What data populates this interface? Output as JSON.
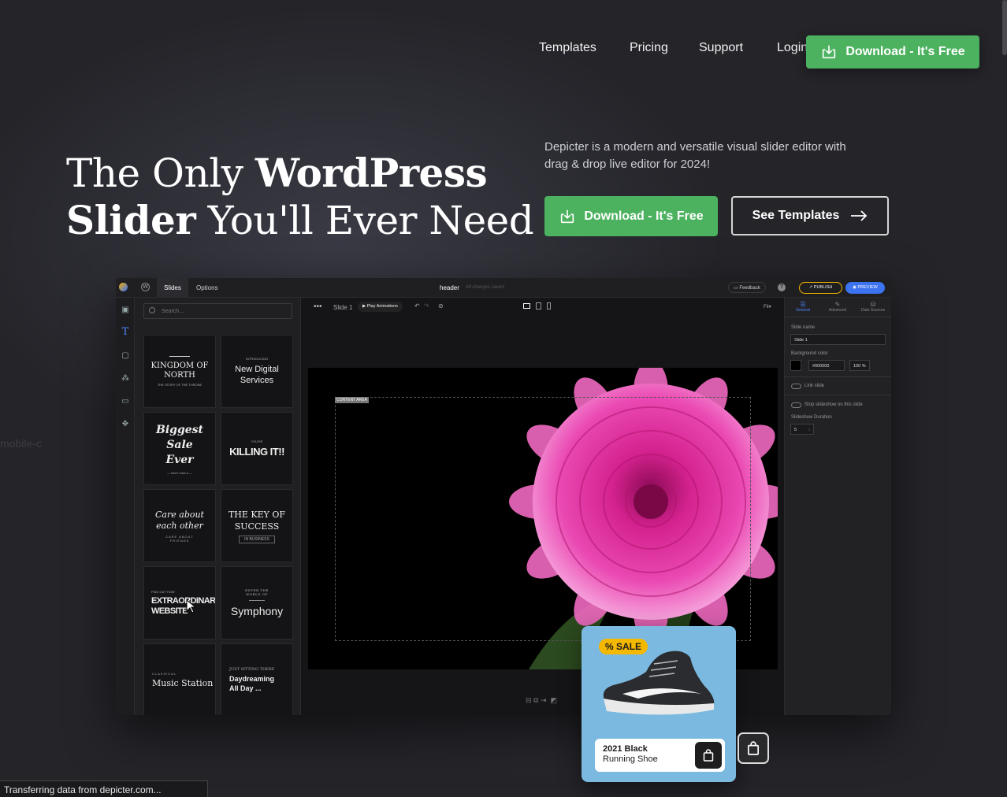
{
  "nav": {
    "links": [
      "Templates",
      "Pricing",
      "Support",
      "Login"
    ],
    "cta": "Download - It's Free"
  },
  "hero": {
    "title_line1_regular": "The Only",
    "title_line1_bold": "WordPress",
    "title_line2_bold": "Slider",
    "title_line2_regular": "You'll Ever Need",
    "description": "Depicter is a modern and versatile visual slider editor with drag & drop live editor for 2024!",
    "primary_button": "Download - It's Free",
    "secondary_button": "See Templates"
  },
  "editor": {
    "tabs": [
      "Slides",
      "Options"
    ],
    "doc_title": "header",
    "saved_status": "All changes saved",
    "feedback": "Feedback",
    "publish": "PUBLISH",
    "preview": "PREVIEW",
    "search_placeholder": "Search...",
    "slide_label": "Slide 1",
    "play_animations": "Play Animations",
    "fit": "Fit",
    "content_area": "CONTENT AREA",
    "right_tabs": [
      "General",
      "Advanced",
      "Data Sources"
    ],
    "slide_name_label": "Slide name",
    "slide_name_value": "Slide 1",
    "bg_color_label": "Background color",
    "bg_color_value": "#000000",
    "bg_opacity": "100 %",
    "link_slide": "Link slide",
    "stop_slideshow": "Stop slideshow on this slide",
    "slideshow_duration_label": "Slideshow Duration",
    "slideshow_duration_value": "5",
    "templates": [
      {
        "title": "KINGDOM OF NORTH",
        "sub": "THE STORY OF THE THRONE"
      },
      {
        "title": "New Digital Services",
        "sub": "INTRODUCING"
      },
      {
        "title": "Biggest Sale Ever",
        "sub": "— Don't miss it —"
      },
      {
        "title": "KILLING IT!!",
        "sub": "YOU'RE"
      },
      {
        "title": "Care about each other",
        "sub": "CARE ABOUT FRIENDS"
      },
      {
        "title": "THE KEY OF SUCCESS",
        "sub": "IN BUSINESS"
      },
      {
        "title": "EXTRAORDINARY WEBSITE",
        "sub": "FIND OUT HOW"
      },
      {
        "title": "Symphony",
        "sub": "ENTER THE WORLD OF"
      },
      {
        "title": "Music Station",
        "sub": "CLASSICAL"
      },
      {
        "title": "Daydreaming All Day ...",
        "sub": "JUST SITTING THERE"
      }
    ]
  },
  "product_card": {
    "badge": "SALE",
    "name_line1": "2021 Black",
    "name_line2": "Running Shoe"
  },
  "side_ghost_text": "mobile-c",
  "status_bar": "Transferring data from depicter.com..."
}
